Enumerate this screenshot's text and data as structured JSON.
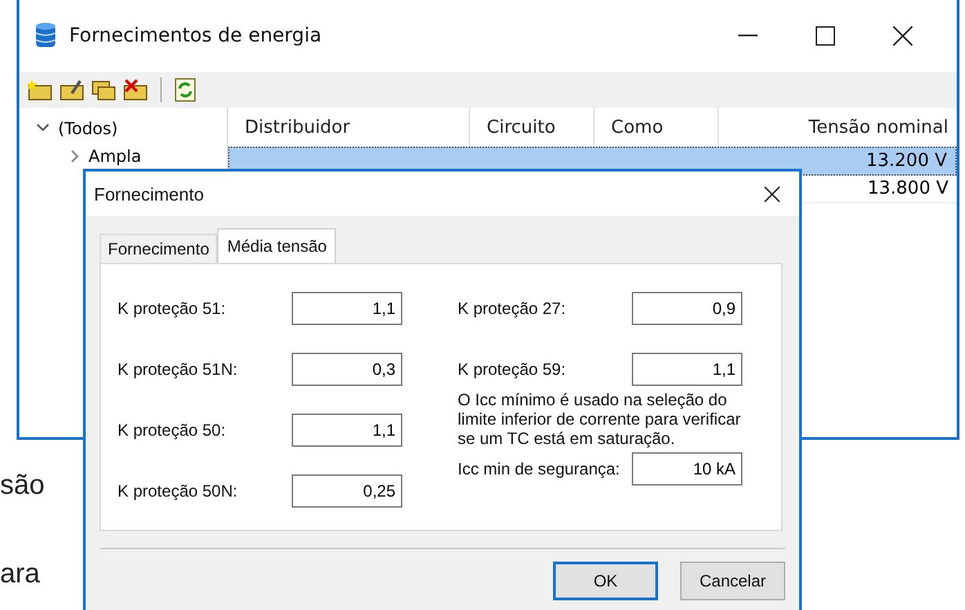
{
  "background_text": [
    "são",
    "ara"
  ],
  "window": {
    "title": "Fornecimentos de energia"
  },
  "tree": {
    "label": "(Todos)",
    "expanded": true,
    "children": [
      {
        "label": "Ampla",
        "expanded": false
      }
    ]
  },
  "table": {
    "columns": [
      "Distribuidor",
      "Circuito",
      "Como",
      "Tensão nominal"
    ],
    "rows": [
      {
        "tensao": "13.200 V",
        "selected": true
      },
      {
        "tensao": "13.800 V",
        "selected": false
      }
    ]
  },
  "dialog": {
    "title": "Fornecimento",
    "tabs": [
      {
        "label": "Fornecimento",
        "selected": false
      },
      {
        "label": "Média tensão",
        "selected": true
      }
    ],
    "left_fields": [
      {
        "label": "K proteção 51:",
        "value": "1,1"
      },
      {
        "label": "K proteção 51N:",
        "value": "0,3"
      },
      {
        "label": "K proteção 50:",
        "value": "1,1"
      },
      {
        "label": "K proteção 50N:",
        "value": "0,25"
      }
    ],
    "right_fields": [
      {
        "label": "K proteção 27:",
        "value": "0,9"
      },
      {
        "label": "K proteção 59:",
        "value": "1,1"
      }
    ],
    "note": "O Icc mínimo é usado na seleção do limite inferior de corrente para verificar se um TC está em saturação.",
    "icc_field": {
      "label": "Icc min de segurança:",
      "value": "10 kA"
    },
    "buttons": [
      {
        "label": "OK",
        "default": true
      },
      {
        "label": "Cancelar",
        "default": false
      }
    ]
  }
}
